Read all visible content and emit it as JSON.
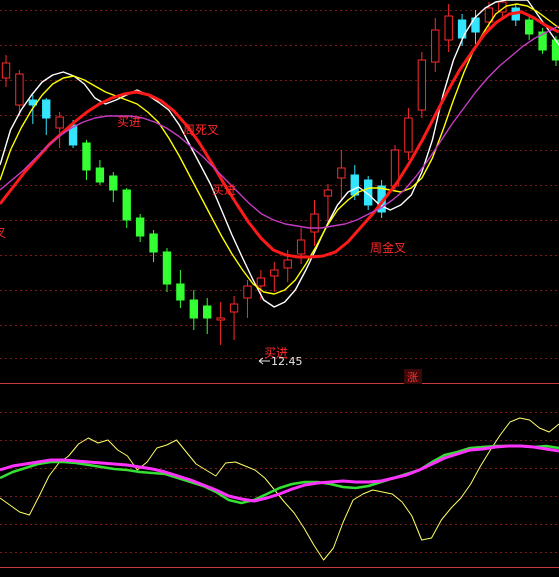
{
  "chart_data": [
    {
      "type": "candlestick",
      "panel": "price",
      "gridlines": "dashed-red-horizontal",
      "colors": {
        "up": "#ff2a2a",
        "down_hollow": "#33e5ff",
        "down_solid": "#33ff33"
      },
      "candles": [
        [
          63,
          87,
          55,
          78,
          "up"
        ],
        [
          74,
          116,
          70,
          105,
          "up"
        ],
        [
          105,
          124,
          95,
          100,
          "down_hollow"
        ],
        [
          100,
          135,
          98,
          118,
          "down_hollow"
        ],
        [
          117,
          148,
          112,
          128,
          "up"
        ],
        [
          125,
          148,
          120,
          145,
          "down_hollow"
        ],
        [
          143,
          180,
          140,
          170,
          "down_solid"
        ],
        [
          168,
          185,
          160,
          182,
          "down_solid"
        ],
        [
          176,
          202,
          172,
          190,
          "down_solid"
        ],
        [
          190,
          228,
          188,
          220,
          "down_solid"
        ],
        [
          218,
          242,
          214,
          236,
          "down_solid"
        ],
        [
          234,
          262,
          230,
          252,
          "down_solid"
        ],
        [
          252,
          292,
          248,
          284,
          "down_solid"
        ],
        [
          284,
          308,
          270,
          300,
          "down_solid"
        ],
        [
          300,
          330,
          290,
          318,
          "down_solid"
        ],
        [
          306,
          334,
          298,
          318,
          "down_solid"
        ],
        [
          318,
          345,
          302,
          320,
          "up"
        ],
        [
          312,
          340,
          296,
          304,
          "up"
        ],
        [
          298,
          318,
          280,
          286,
          "up"
        ],
        [
          286,
          300,
          270,
          278,
          "up"
        ],
        [
          276,
          292,
          262,
          270,
          "up"
        ],
        [
          260,
          282,
          250,
          268,
          "up"
        ],
        [
          240,
          264,
          228,
          254,
          "up"
        ],
        [
          214,
          246,
          200,
          232,
          "up"
        ],
        [
          190,
          222,
          184,
          196,
          "up"
        ],
        [
          168,
          200,
          150,
          178,
          "up"
        ],
        [
          175,
          200,
          165,
          195,
          "down_hollow"
        ],
        [
          180,
          210,
          176,
          205,
          "down_hollow"
        ],
        [
          186,
          218,
          180,
          212,
          "down_hollow"
        ],
        [
          150,
          190,
          145,
          186,
          "up"
        ],
        [
          118,
          160,
          108,
          152,
          "up"
        ],
        [
          60,
          118,
          52,
          110,
          "up"
        ],
        [
          30,
          72,
          18,
          62,
          "up"
        ],
        [
          16,
          52,
          4,
          40,
          "up"
        ],
        [
          20,
          46,
          14,
          38,
          "down_hollow"
        ],
        [
          18,
          44,
          10,
          32,
          "down_hollow"
        ],
        [
          8,
          30,
          2,
          22,
          "up"
        ],
        [
          2,
          18,
          0,
          12,
          "up"
        ],
        [
          8,
          26,
          4,
          20,
          "down_hollow"
        ],
        [
          20,
          40,
          16,
          34,
          "down_solid"
        ],
        [
          32,
          54,
          28,
          50,
          "down_solid"
        ],
        [
          40,
          66,
          36,
          60,
          "down_solid"
        ]
      ],
      "ma_lines": [
        {
          "color": "#ffffff",
          "values": [
            165,
            130,
            110,
            95,
            82,
            75,
            72,
            76,
            84,
            98,
            104,
            100,
            95,
            90,
            95,
            102,
            110,
            125,
            145,
            165,
            185,
            210,
            235,
            258,
            280,
            300,
            307,
            302,
            290,
            270,
            248,
            225,
            205,
            192,
            187,
            195,
            205,
            210,
            205,
            195,
            172,
            140,
            95,
            60,
            35,
            18,
            8,
            2,
            0,
            0,
            0,
            15,
            30,
            45
          ]
        },
        {
          "color": "#ffff00",
          "values": [
            180,
            150,
            128,
            110,
            95,
            84,
            78,
            76,
            80,
            86,
            92,
            96,
            100,
            104,
            112,
            122,
            138,
            156,
            176,
            196,
            216,
            236,
            254,
            270,
            284,
            292,
            294,
            290,
            280,
            264,
            246,
            226,
            210,
            200,
            192,
            188,
            188,
            190,
            192,
            188,
            178,
            158,
            130,
            100,
            72,
            48,
            30,
            14,
            6,
            4,
            6,
            12,
            20,
            28
          ]
        },
        {
          "color": "#ff1a1a",
          "width": 3,
          "values": [
            204,
            188,
            172,
            158,
            144,
            133,
            122,
            112,
            104,
            98,
            94,
            92,
            95,
            101,
            111,
            125,
            142,
            162,
            183,
            203,
            222,
            238,
            250,
            255,
            257,
            257,
            256,
            252,
            242,
            228,
            214,
            198,
            182,
            162,
            140,
            116,
            92,
            70,
            52,
            34,
            22,
            14,
            12,
            18,
            26,
            32
          ]
        },
        {
          "color": "#c43cc4",
          "values": [
            190,
            180,
            170,
            158,
            146,
            136,
            128,
            122,
            118,
            116,
            116,
            116,
            118,
            122,
            128,
            136,
            146,
            156,
            168,
            180,
            192,
            204,
            214,
            220,
            224,
            226,
            228,
            228,
            226,
            224,
            220,
            214,
            208,
            200,
            190,
            176,
            160,
            142,
            124,
            108,
            92,
            78,
            66,
            56,
            46,
            38,
            32,
            26
          ]
        }
      ],
      "annotations": [
        {
          "text": "买进"
        },
        {
          "text": "周死叉"
        },
        {
          "text": "买进"
        },
        {
          "text": "周金叉"
        },
        {
          "text": "买进"
        },
        {
          "text": "叉"
        },
        {
          "text": "12.45"
        },
        {
          "text": "涨"
        }
      ]
    },
    {
      "type": "line",
      "panel": "indicator",
      "series": [
        {
          "color": "#ffff66",
          "values": [
            498,
            505,
            512,
            515,
            496,
            476,
            463,
            456,
            444,
            438,
            443,
            440,
            450,
            456,
            470,
            462,
            448,
            445,
            440,
            452,
            464,
            470,
            476,
            463,
            462,
            466,
            470,
            478,
            490,
            502,
            513,
            528,
            545,
            560,
            548,
            522,
            500,
            494,
            490,
            492,
            494,
            502,
            516,
            540,
            538,
            520,
            508,
            498,
            484,
            466,
            450,
            435,
            422,
            418,
            420,
            428,
            432,
            424
          ]
        },
        {
          "color": "#33e033",
          "width": 2.5,
          "values": [
            478,
            472,
            468,
            464,
            462,
            462,
            463,
            465,
            467,
            469,
            470,
            472,
            473,
            474,
            478,
            482,
            486,
            492,
            500,
            503,
            500,
            494,
            488,
            484,
            482,
            482,
            484,
            487,
            488,
            486,
            482,
            478,
            474,
            470,
            462,
            455,
            452,
            448,
            447,
            446,
            446,
            446,
            447,
            446,
            448
          ]
        },
        {
          "color": "#ff33ff",
          "width": 3,
          "values": [
            470,
            466,
            464,
            462,
            460,
            460,
            461,
            462,
            463,
            464,
            465,
            467,
            469,
            472,
            476,
            480,
            485,
            490,
            496,
            499,
            501,
            498,
            494,
            489,
            485,
            483,
            482,
            481,
            482,
            482,
            481,
            478,
            475,
            470,
            464,
            458,
            454,
            450,
            449,
            447,
            446,
            446,
            447,
            449,
            451
          ]
        }
      ]
    }
  ]
}
